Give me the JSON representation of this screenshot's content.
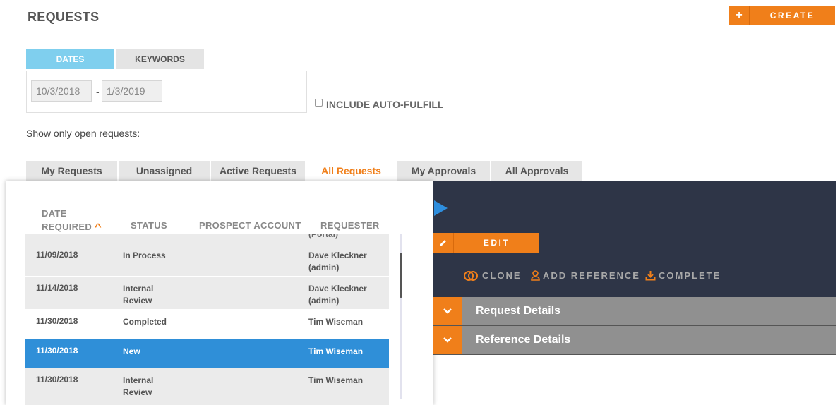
{
  "header": {
    "title": "REQUESTS",
    "create_plus": "+",
    "create_label": "CREATE"
  },
  "filters": {
    "tabs": [
      "DATES",
      "KEYWORDS"
    ],
    "date_from": "10/3/2018",
    "date_separator": "-",
    "date_to": "1/3/2019",
    "include_auto_fulfill": "INCLUDE AUTO-FULFILL",
    "show_open_label": "Show only open requests:"
  },
  "request_tabs": [
    "My Requests",
    "Unassigned",
    "Active Requests",
    "All Requests",
    "My Approvals",
    "All Approvals"
  ],
  "active_tab": "All Requests",
  "table": {
    "headers": {
      "date_line1": "DATE",
      "date_line2": "REQUIRED",
      "status": "STATUS",
      "prospect": "PROSPECT ACCOUNT",
      "requester": "REQUESTER"
    },
    "partial_row_requester": "(Portal)",
    "rows": [
      {
        "date": "11/09/2018",
        "status_l1": "In Process",
        "status_l2": "",
        "req_l1": "Dave Kleckner",
        "req_l2": "(admin)",
        "style": "gray"
      },
      {
        "date": "11/14/2018",
        "status_l1": "Internal",
        "status_l2": "Review",
        "req_l1": "Dave Kleckner",
        "req_l2": "(admin)",
        "style": "gray"
      },
      {
        "date": "11/30/2018",
        "status_l1": "Completed",
        "status_l2": "",
        "req_l1": "Tim Wiseman",
        "req_l2": "",
        "style": "white"
      },
      {
        "date": "11/30/2018",
        "status_l1": "New",
        "status_l2": "",
        "req_l1": "Tim Wiseman",
        "req_l2": "",
        "style": "selected"
      },
      {
        "date": "11/30/2018",
        "status_l1": "Internal",
        "status_l2": "Review",
        "req_l1": "Tim Wiseman",
        "req_l2": "",
        "style": "gray"
      }
    ]
  },
  "detail": {
    "edit_label": "EDIT",
    "actions": {
      "clone": "CLONE",
      "add_reference": "ADD REFERENCE",
      "complete": "COMPLETE"
    },
    "sections": [
      "Request Details",
      "Reference Details"
    ]
  },
  "colors": {
    "accent": "#f07f1a",
    "selected": "#2f8fd8",
    "dark_panel": "#2e3547",
    "tab_active_bg": "#7fcfee"
  }
}
